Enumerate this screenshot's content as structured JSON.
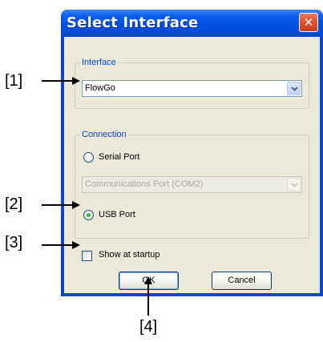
{
  "dialog": {
    "title": "Select Interface",
    "close_symbol": "✕",
    "interface_group": {
      "legend": "Interface",
      "selected": "FlowGo"
    },
    "connection_group": {
      "legend": "Connection",
      "serial_port_label": "Serial Port",
      "serial_port_selected": false,
      "com_port_value": "Communications Port (COM2)",
      "com_port_enabled": false,
      "usb_port_label": "USB Port",
      "usb_port_selected": true
    },
    "show_at_startup_label": "Show at startup",
    "show_at_startup_checked": false,
    "ok_label": "OK",
    "cancel_label": "Cancel"
  },
  "callouts": {
    "c1": "[1]",
    "c2": "[2]",
    "c3": "[3]",
    "c4": "[4]"
  },
  "colors": {
    "title_bar": "#0250e0",
    "client_bg": "#ece9d8",
    "group_legend": "#0046d5",
    "close_button": "#e0512e",
    "radio_selected_dot": "#3cb43c"
  },
  "icons": {
    "close": "close-icon",
    "dropdown": "chevron-down-icon",
    "callout_arrow": "arrow-right-icon"
  }
}
